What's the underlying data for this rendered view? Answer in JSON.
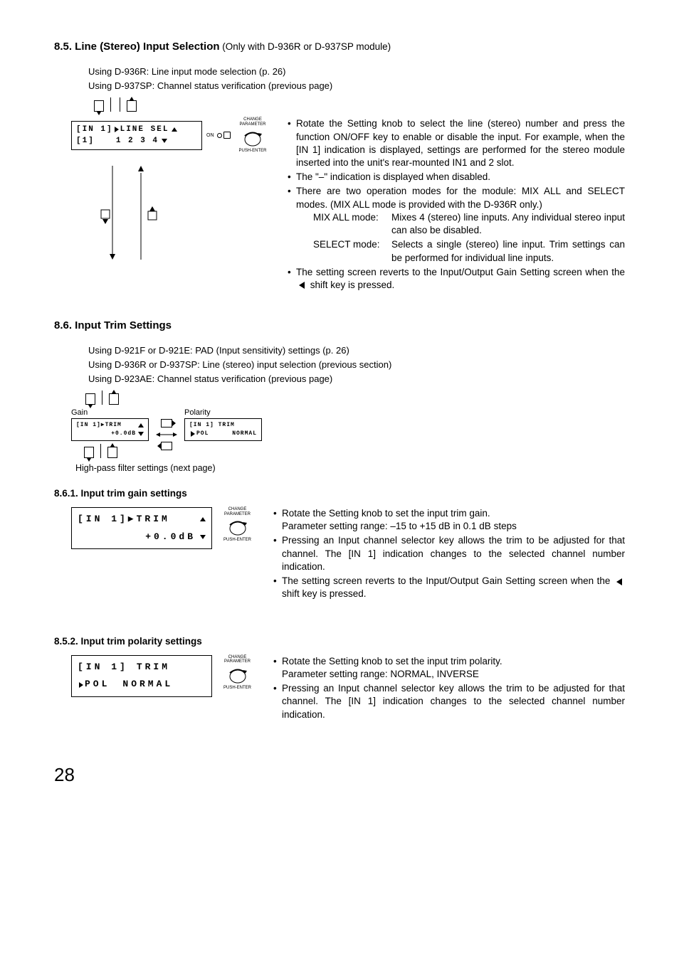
{
  "s85": {
    "title_num": "8.5. Line (Stereo) Input Selection",
    "title_note": " (Only with D-936R or D-937SP module)",
    "usage": [
      "Using D-936R: Line input mode selection (p. 26)",
      "Using D-937SP: Channel status verification (previous page)"
    ],
    "lcd": {
      "line1_left": "[IN 1]",
      "line1_right": "LINE SEL",
      "line2_left": "[1]",
      "line2_right": "1 2 3 4"
    },
    "knob": {
      "top": "CHANGE",
      "top2": "PARAMETER",
      "bottom": "PUSH-ENTER",
      "on": "ON"
    },
    "bullets": [
      "Rotate the Setting knob to select the line (stereo) number and press the function ON/OFF key to enable or disable the input. For example, when the [IN 1] indication is displayed, settings are performed for the stereo module inserted into the unit's rear-mounted IN1 and 2 slot.",
      "The \"–\" indication is displayed when disabled.",
      "There are two operation modes for the module: MIX ALL and SELECT modes. (MIX ALL mode is provided with the D-936R only.)"
    ],
    "modes": {
      "mixall_label": "MIX ALL mode:",
      "mixall_text": "Mixes 4 (stereo) line inputs. Any individual stereo input can also be disabled.",
      "select_label": "SELECT mode:",
      "select_text": "Selects a single (stereo) line input. Trim settings can be performed for individual line inputs."
    },
    "bullet_last_a": "The setting screen reverts to the Input/Output Gain Setting screen when the ",
    "bullet_last_b": " shift key is pressed."
  },
  "s86": {
    "title": "8.6. Input Trim Settings",
    "usage": [
      "Using D-921F or D-921E: PAD (Input sensitivity) settings (p. 26)",
      "Using D-936R or D-937SP: Line (stereo) input selection (previous section)",
      "Using D-923AE: Channel status verification (previous page)"
    ],
    "fig": {
      "gain_label": "Gain",
      "polarity_label": "Polarity",
      "gain_lcd_l1": "[IN 1]▶TRIM",
      "gain_lcd_l2": "+0.0dB",
      "pol_lcd_l1": "[IN 1] TRIM",
      "pol_lcd_l2_left": "POL",
      "pol_lcd_l2_right": "NORMAL",
      "caption": "High-pass filter settings (next page)"
    }
  },
  "s861": {
    "title": "8.6.1. Input trim gain settings",
    "lcd_l1": "[IN 1]▶TRIM",
    "lcd_l2": "+0.0dB",
    "bullets": [
      "Rotate the Setting knob to set the input trim gain.",
      "Pressing an Input channel selector key allows the trim to be adjusted for that channel. The [IN 1] indication changes to the selected channel number indication."
    ],
    "range": "Parameter setting range: –15 to +15 dB in 0.1 dB steps",
    "last_a": "The setting screen reverts to the Input/Output Gain Setting screen when the ",
    "last_b": " shift key is pressed."
  },
  "s852": {
    "title": "8.5.2. Input trim polarity settings",
    "lcd_l1a": "[IN 1]",
    "lcd_l1b": "TRIM",
    "lcd_l2_left": "POL",
    "lcd_l2_right": "NORMAL",
    "bullets": [
      "Rotate the Setting knob to set the input trim polarity.",
      "Pressing an Input channel selector key allows the trim to be adjusted for that channel. The [IN 1] indication changes to the selected channel number indication."
    ],
    "range": "Parameter setting range: NORMAL, INVERSE"
  },
  "knob": {
    "top": "CHANGE",
    "top2": "PARAMETER",
    "bottom": "PUSH-ENTER"
  },
  "page": "28"
}
